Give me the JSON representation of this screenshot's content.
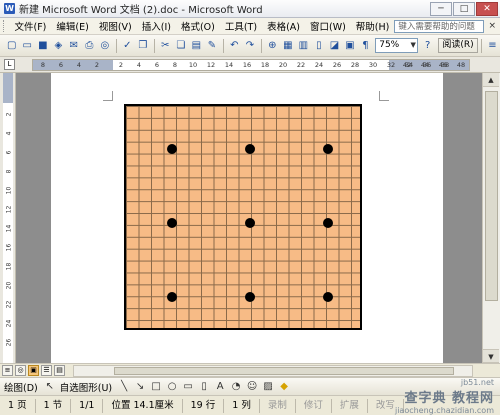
{
  "window": {
    "title": "新建 Microsoft Word 文档 (2).doc - Microsoft Word",
    "minimize": "─",
    "maximize": "□",
    "close": "✕"
  },
  "menubar": {
    "items": [
      "文件(F)",
      "编辑(E)",
      "视图(V)",
      "插入(I)",
      "格式(O)",
      "工具(T)",
      "表格(A)",
      "窗口(W)",
      "帮助(H)"
    ],
    "help_placeholder": "键入需要帮助的问题",
    "close_doc": "×"
  },
  "toolbar": {
    "zoom": "75%",
    "read_label": "阅读(R)"
  },
  "ruler": {
    "corner": "L",
    "ticks_left": [
      "8",
      "6",
      "4",
      "2"
    ],
    "ticks_main": [
      "2",
      "4",
      "6",
      "8",
      "10",
      "12",
      "14",
      "16",
      "18",
      "20",
      "22",
      "24",
      "26",
      "28",
      "30",
      "32",
      "34",
      "36",
      "38"
    ],
    "ticks_right": [
      "42",
      "44",
      "46",
      "48"
    ],
    "vticks": [
      "2",
      "4",
      "6",
      "8",
      "10",
      "12",
      "14",
      "16",
      "18",
      "20",
      "22",
      "24",
      "26"
    ]
  },
  "board": {
    "rows": 18,
    "cols": 18,
    "fill": "#f7bb86",
    "stones": [
      {
        "col": 3,
        "row": 3
      },
      {
        "col": 9,
        "row": 3
      },
      {
        "col": 15,
        "row": 3
      },
      {
        "col": 3,
        "row": 9
      },
      {
        "col": 9,
        "row": 9
      },
      {
        "col": 15,
        "row": 9
      },
      {
        "col": 3,
        "row": 15
      },
      {
        "col": 9,
        "row": 15
      },
      {
        "col": 15,
        "row": 15
      }
    ]
  },
  "drawbar": {
    "draw_label": "绘图(D)",
    "autoshape_label": "自选图形(U)"
  },
  "statusbar": {
    "page": "1 页",
    "section": "1 节",
    "page_of": "1/1",
    "position": "位置 14.1厘米",
    "line": "19 行",
    "column": "1 列",
    "rec": "录制",
    "trk": "修订",
    "ext": "扩展",
    "ovr": "改写"
  },
  "watermark": {
    "text": "查字典 教程网",
    "url": "jiaocheng.chazidian.com",
    "site": "jb51.net"
  }
}
